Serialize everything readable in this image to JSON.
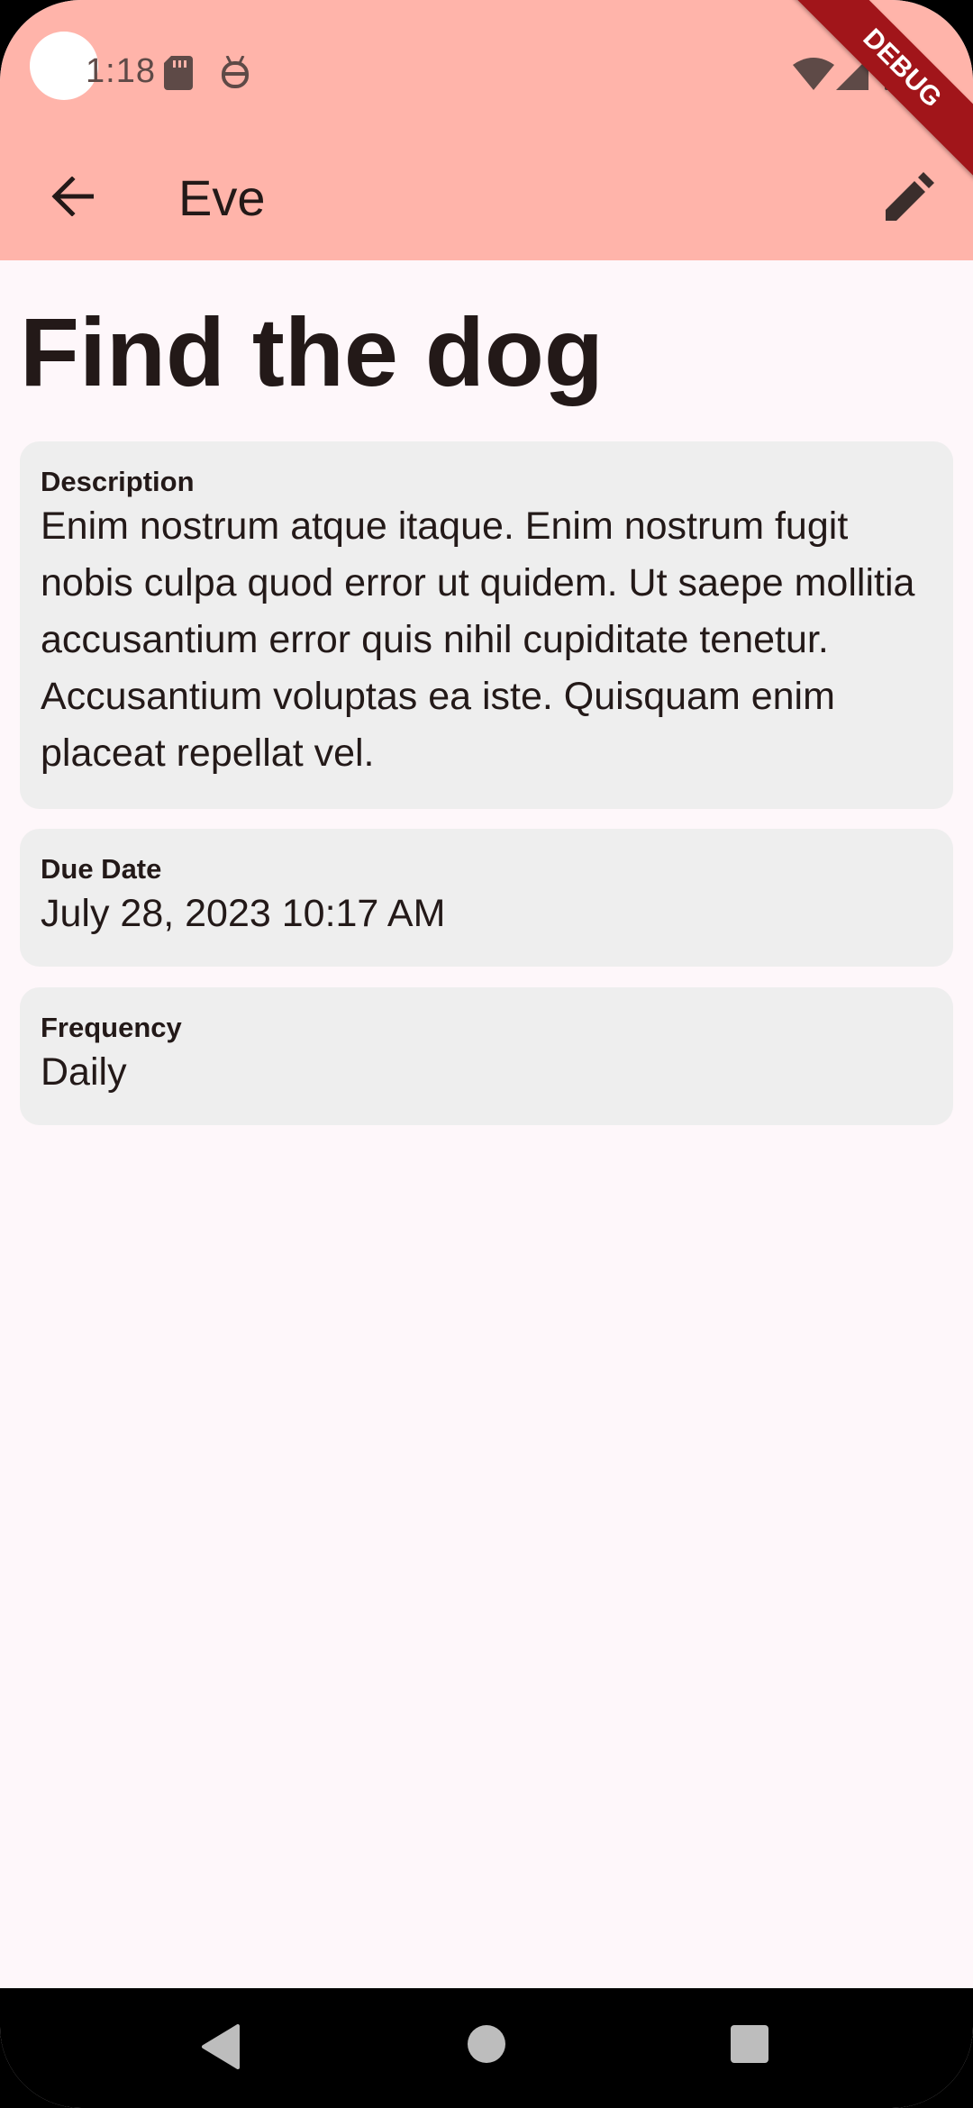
{
  "status_bar": {
    "time": "1:18"
  },
  "debug_banner": "DEBUG",
  "app_bar": {
    "title": "Eve",
    "back_icon": "arrow-back-icon",
    "edit_icon": "pencil-icon"
  },
  "task": {
    "title": "Find the dog",
    "fields": [
      {
        "label": "Description",
        "value": "Enim nostrum atque itaque. Enim nostrum fugit nobis culpa quod error ut quidem. Ut saepe mollitia accusantium error quis nihil cupiditate tenetur. Accusantium voluptas ea iste. Quisquam enim placeat repellat vel."
      },
      {
        "label": "Due Date",
        "value": "July 28, 2023 10:17 AM"
      },
      {
        "label": "Frequency",
        "value": "Daily"
      }
    ]
  },
  "colors": {
    "app_bar": "#ffb4aa",
    "background": "#fef7fa",
    "card": "#eeeeee",
    "text": "#231918"
  }
}
